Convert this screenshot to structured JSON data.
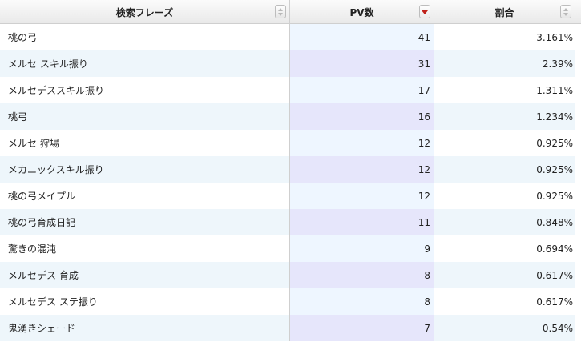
{
  "columns": [
    {
      "label": "検索フレーズ",
      "sort": "none"
    },
    {
      "label": "PV数",
      "sort": "desc"
    },
    {
      "label": "割合",
      "sort": "none"
    }
  ],
  "rows": [
    {
      "phrase": "桃の弓",
      "pv": "41",
      "ratio": "3.161%"
    },
    {
      "phrase": "メルセ スキル振り",
      "pv": "31",
      "ratio": "2.39%"
    },
    {
      "phrase": "メルセデススキル振り",
      "pv": "17",
      "ratio": "1.311%"
    },
    {
      "phrase": "桃弓",
      "pv": "16",
      "ratio": "1.234%"
    },
    {
      "phrase": "メルセ 狩場",
      "pv": "12",
      "ratio": "0.925%"
    },
    {
      "phrase": "メカニックスキル振り",
      "pv": "12",
      "ratio": "0.925%"
    },
    {
      "phrase": "桃の弓メイプル",
      "pv": "12",
      "ratio": "0.925%"
    },
    {
      "phrase": "桃の弓育成日記",
      "pv": "11",
      "ratio": "0.848%"
    },
    {
      "phrase": "驚きの混沌",
      "pv": "9",
      "ratio": "0.694%"
    },
    {
      "phrase": "メルセデス 育成",
      "pv": "8",
      "ratio": "0.617%"
    },
    {
      "phrase": "メルセデス ステ振り",
      "pv": "8",
      "ratio": "0.617%"
    },
    {
      "phrase": "鬼湧きシェード",
      "pv": "7",
      "ratio": "0.54%"
    }
  ]
}
